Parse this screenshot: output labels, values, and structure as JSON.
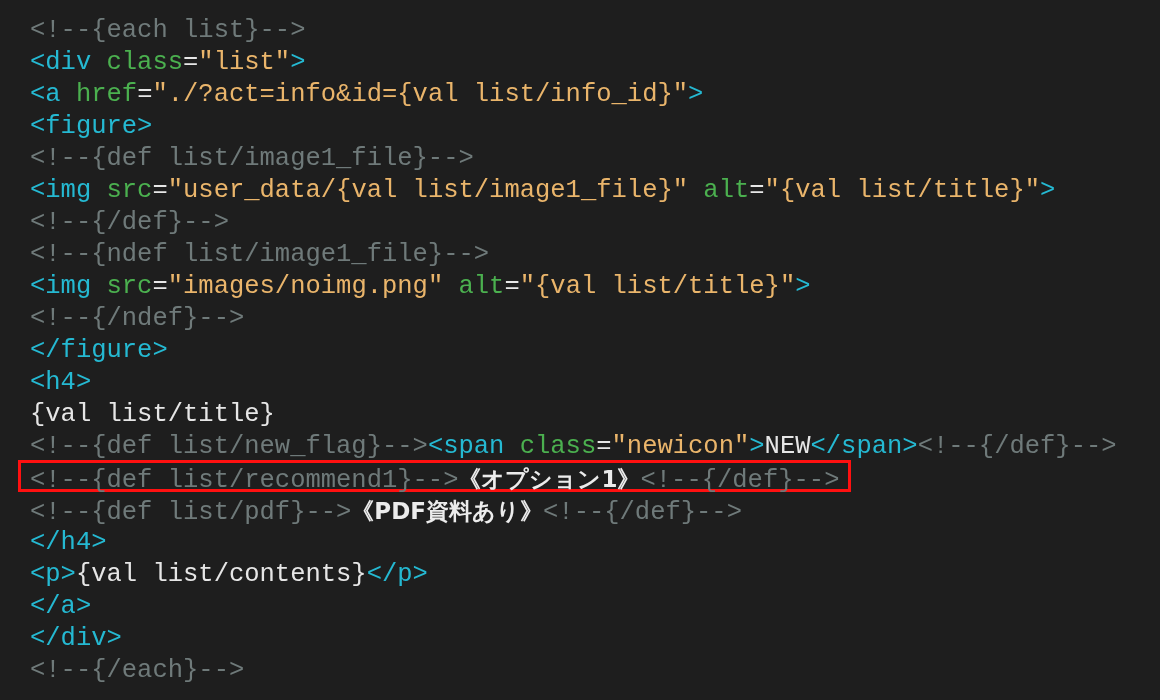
{
  "lines": [
    {
      "highlighted": false,
      "tokens": [
        {
          "kind": "comment",
          "text": "<!--{each list}-->"
        }
      ]
    },
    {
      "highlighted": false,
      "tokens": [
        {
          "kind": "tag",
          "text": "<div "
        },
        {
          "kind": "attr",
          "text": "class"
        },
        {
          "kind": "plain",
          "text": "="
        },
        {
          "kind": "string",
          "text": "\"list\""
        },
        {
          "kind": "tag",
          "text": ">"
        }
      ]
    },
    {
      "highlighted": false,
      "tokens": [
        {
          "kind": "tag",
          "text": "<a "
        },
        {
          "kind": "attr",
          "text": "href"
        },
        {
          "kind": "plain",
          "text": "="
        },
        {
          "kind": "string",
          "text": "\"./?act=info&id={val list/info_id}\""
        },
        {
          "kind": "tag",
          "text": ">"
        }
      ]
    },
    {
      "highlighted": false,
      "tokens": [
        {
          "kind": "tag",
          "text": "<figure>"
        }
      ]
    },
    {
      "highlighted": false,
      "tokens": [
        {
          "kind": "comment",
          "text": "<!--{def list/image1_file}-->"
        }
      ]
    },
    {
      "highlighted": false,
      "tokens": [
        {
          "kind": "tag",
          "text": "<img "
        },
        {
          "kind": "attr",
          "text": "src"
        },
        {
          "kind": "plain",
          "text": "="
        },
        {
          "kind": "string",
          "text": "\"user_data/{val list/image1_file}\""
        },
        {
          "kind": "attr",
          "text": " alt"
        },
        {
          "kind": "plain",
          "text": "="
        },
        {
          "kind": "string",
          "text": "\"{val list/title}\""
        },
        {
          "kind": "tag",
          "text": ">"
        }
      ]
    },
    {
      "highlighted": false,
      "tokens": [
        {
          "kind": "comment",
          "text": "<!--{/def}-->"
        }
      ]
    },
    {
      "highlighted": false,
      "tokens": [
        {
          "kind": "comment",
          "text": "<!--{ndef list/image1_file}-->"
        }
      ]
    },
    {
      "highlighted": false,
      "tokens": [
        {
          "kind": "tag",
          "text": "<img "
        },
        {
          "kind": "attr",
          "text": "src"
        },
        {
          "kind": "plain",
          "text": "="
        },
        {
          "kind": "string",
          "text": "\"images/noimg.png\""
        },
        {
          "kind": "attr",
          "text": " alt"
        },
        {
          "kind": "plain",
          "text": "="
        },
        {
          "kind": "string",
          "text": "\"{val list/title}\""
        },
        {
          "kind": "tag",
          "text": ">"
        }
      ]
    },
    {
      "highlighted": false,
      "tokens": [
        {
          "kind": "comment",
          "text": "<!--{/ndef}-->"
        }
      ]
    },
    {
      "highlighted": false,
      "tokens": [
        {
          "kind": "tag",
          "text": "</figure>"
        }
      ]
    },
    {
      "highlighted": false,
      "tokens": [
        {
          "kind": "tag",
          "text": "<h4>"
        }
      ]
    },
    {
      "highlighted": false,
      "tokens": [
        {
          "kind": "plain",
          "text": "{val list/title}"
        }
      ]
    },
    {
      "highlighted": false,
      "tokens": [
        {
          "kind": "comment",
          "text": "<!--{def list/new_flag}-->"
        },
        {
          "kind": "tag",
          "text": "<span "
        },
        {
          "kind": "attr",
          "text": "class"
        },
        {
          "kind": "plain",
          "text": "="
        },
        {
          "kind": "string",
          "text": "\"newicon\""
        },
        {
          "kind": "tag",
          "text": ">"
        },
        {
          "kind": "plain",
          "text": "NEW"
        },
        {
          "kind": "tag",
          "text": "</span>"
        },
        {
          "kind": "comment",
          "text": "<!--{/def}-->"
        }
      ]
    },
    {
      "highlighted": true,
      "tokens": [
        {
          "kind": "comment",
          "text": "<!--{def list/recommend1}-->"
        },
        {
          "kind": "bold",
          "text": "《オプション1》"
        },
        {
          "kind": "comment",
          "text": "<!--{/def}-->"
        }
      ]
    },
    {
      "highlighted": false,
      "tokens": [
        {
          "kind": "comment",
          "text": "<!--{def list/pdf}-->"
        },
        {
          "kind": "bold",
          "text": "《PDF資料あり》"
        },
        {
          "kind": "comment",
          "text": "<!--{/def}-->"
        }
      ]
    },
    {
      "highlighted": false,
      "tokens": [
        {
          "kind": "tag",
          "text": "</h4>"
        }
      ]
    },
    {
      "highlighted": false,
      "tokens": [
        {
          "kind": "tag",
          "text": "<p>"
        },
        {
          "kind": "plain",
          "text": "{val list/contents}"
        },
        {
          "kind": "tag",
          "text": "</p>"
        }
      ]
    },
    {
      "highlighted": false,
      "tokens": [
        {
          "kind": "tag",
          "text": "</a>"
        }
      ]
    },
    {
      "highlighted": false,
      "tokens": [
        {
          "kind": "tag",
          "text": "</div>"
        }
      ]
    },
    {
      "highlighted": false,
      "tokens": [
        {
          "kind": "comment",
          "text": "<!--{/each}-->"
        }
      ]
    }
  ]
}
